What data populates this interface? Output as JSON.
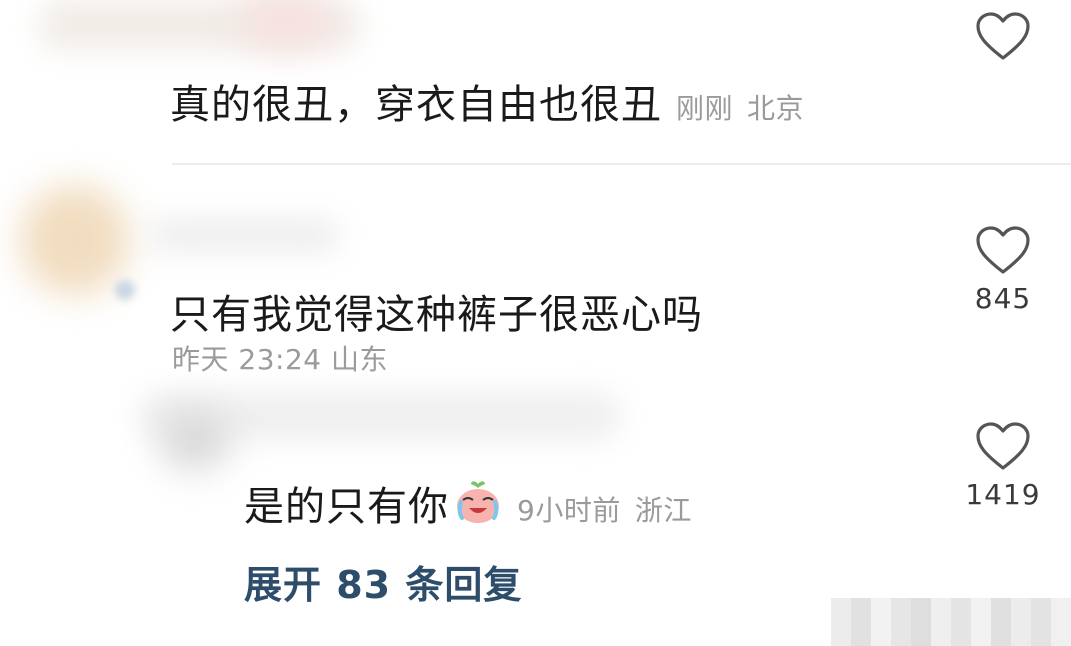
{
  "comments": [
    {
      "text": "真的很丑，穿衣自由也很丑",
      "time": "刚刚",
      "location": "北京",
      "like_count": ""
    },
    {
      "text": "只有我觉得这种裤子很恶心吗",
      "meta": "昨天 23:24 山东",
      "like_count": "845"
    }
  ],
  "reply": {
    "text": "是的只有你",
    "emoji": "crying-laughing-emoji",
    "time": "9小时前",
    "location": "浙江",
    "like_count": "1419"
  },
  "expand_replies": {
    "label": "展开 83 条回复"
  },
  "colors": {
    "text": "#1a1a1a",
    "meta": "#9a9a9a",
    "link": "#2d4d6b",
    "divider": "#ececec"
  }
}
